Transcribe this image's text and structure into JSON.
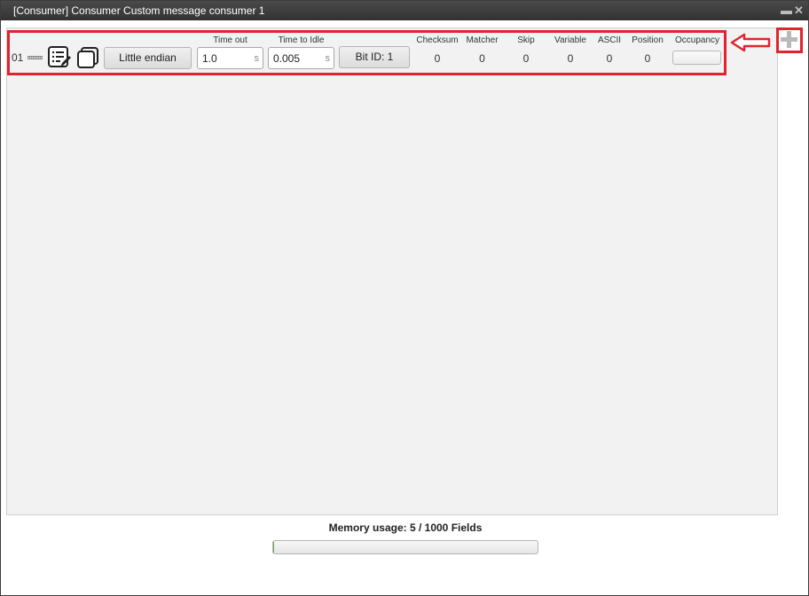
{
  "window": {
    "title": "[Consumer] Consumer Custom message consumer 1",
    "minimize_glyph": "▬",
    "close_glyph": "✕"
  },
  "row": {
    "index": "01",
    "endian_label": "Little endian",
    "timeout": {
      "label": "Time out",
      "value": "1.0",
      "unit": "s"
    },
    "idle": {
      "label": "Time to Idle",
      "value": "0.005",
      "unit": "s"
    },
    "bitid_label": "Bit ID: 1",
    "stats": {
      "checksum": {
        "label": "Checksum",
        "value": "0"
      },
      "matcher": {
        "label": "Matcher",
        "value": "0"
      },
      "skip": {
        "label": "Skip",
        "value": "0"
      },
      "variable": {
        "label": "Variable",
        "value": "0"
      },
      "ascii": {
        "label": "ASCII",
        "value": "0"
      },
      "position": {
        "label": "Position",
        "value": "0"
      }
    },
    "occupancy": {
      "label": "Occupancy",
      "fraction": 0.0
    },
    "icons": {
      "edit": "edit-list-icon",
      "copy": "copy-icon",
      "drag": "drag-handle-icon"
    }
  },
  "add_button": {
    "icon": "plus-icon"
  },
  "memory": {
    "label": "Memory usage: 5 / 1000 Fields",
    "used": 5,
    "total": 1000
  },
  "colors": {
    "highlight": "#e0242f",
    "titlebar": "#3a3a3a",
    "panel": "#f2f2f2"
  }
}
